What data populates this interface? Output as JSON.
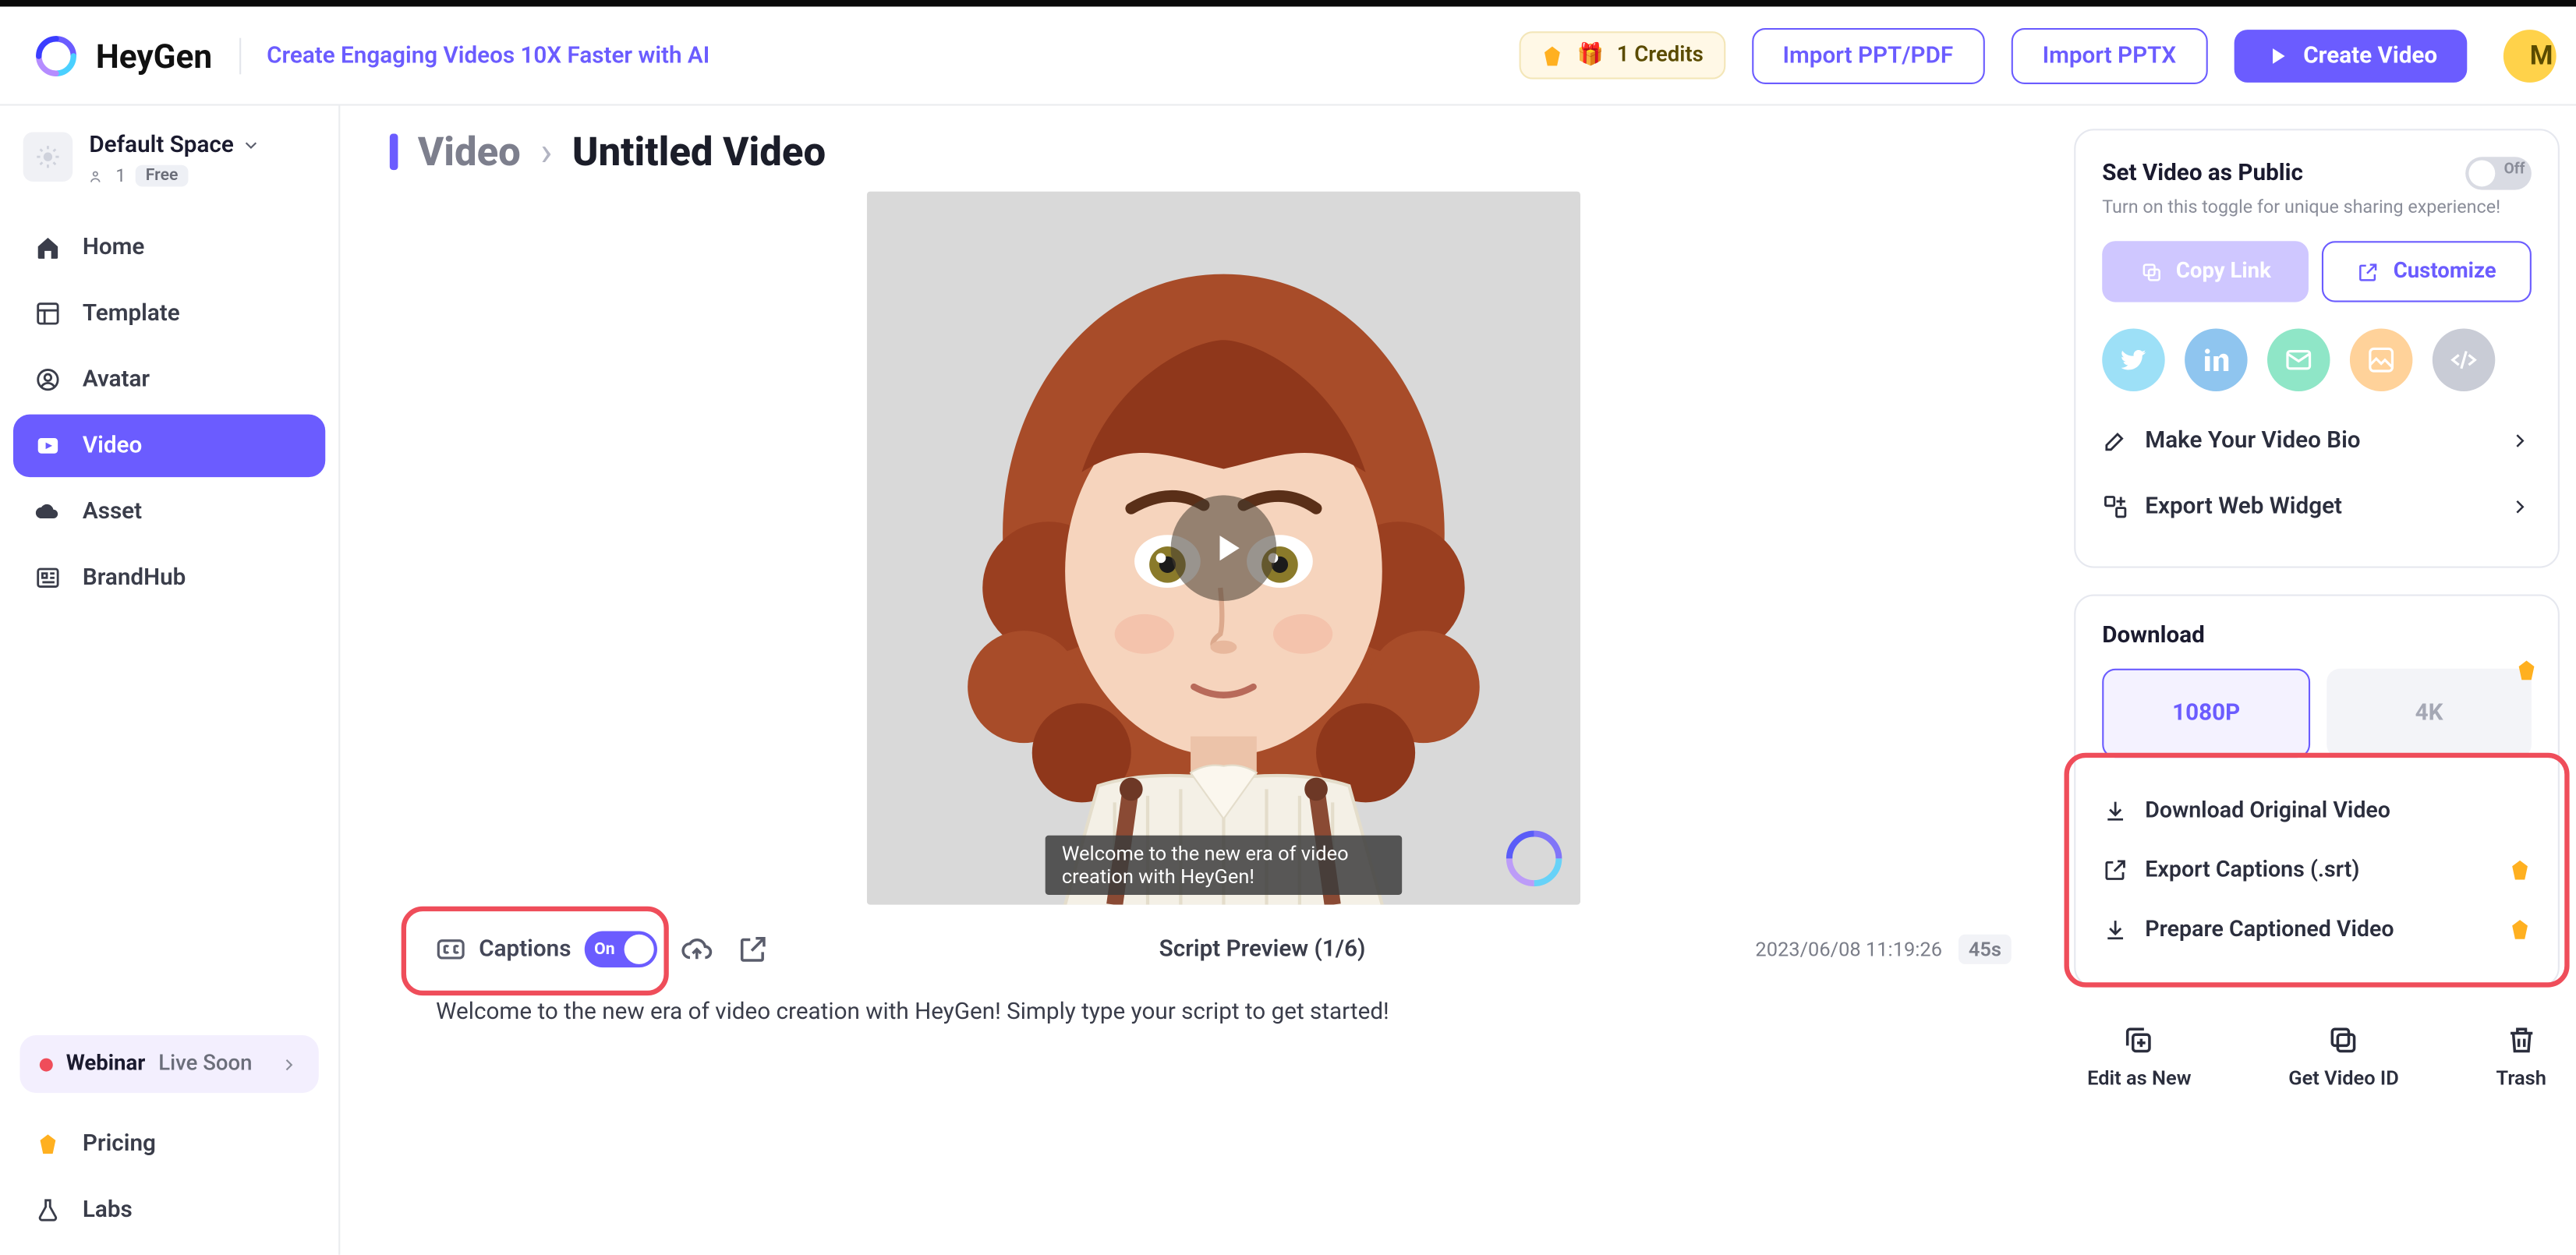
{
  "header": {
    "brand": "HeyGen",
    "tagline": "Create Engaging Videos 10X Faster with AI",
    "credits_label": "1 Credits",
    "import_ppt_pdf": "Import PPT/PDF",
    "import_pptx": "Import PPTX",
    "create_video": "Create Video",
    "avatar_letter": "M"
  },
  "space": {
    "name": "Default Space",
    "members": "1",
    "plan": "Free"
  },
  "nav": {
    "home": "Home",
    "template": "Template",
    "avatar": "Avatar",
    "video": "Video",
    "asset": "Asset",
    "brandhub": "BrandHub",
    "pricing": "Pricing",
    "labs": "Labs"
  },
  "webinar": {
    "label": "Webinar",
    "sub": "Live Soon"
  },
  "breadcrumb": {
    "root": "Video",
    "current": "Untitled Video"
  },
  "player": {
    "caption_overlay": "Welcome to the new era of video creation with HeyGen!",
    "captions_label": "Captions",
    "captions_state": "On",
    "script_preview": "Script Preview (1/6)",
    "timestamp": "2023/06/08 11:19:26",
    "duration": "45s",
    "script_text": "Welcome to the new era of video creation with HeyGen! Simply type your script to get started!"
  },
  "share": {
    "public_title": "Set Video as Public",
    "public_state": "Off",
    "public_hint": "Turn on this toggle for unique sharing experience!",
    "copy_link": "Copy Link",
    "customize": "Customize",
    "bio": "Make Your Video Bio",
    "widget": "Export Web Widget"
  },
  "download": {
    "title": "Download",
    "opt_1080": "1080P",
    "opt_4k": "4K",
    "orig": "Download Original Video",
    "srt": "Export Captions (.srt)",
    "captioned": "Prepare Captioned Video"
  },
  "actions": {
    "edit": "Edit as New",
    "getid": "Get Video ID",
    "trash": "Trash"
  }
}
